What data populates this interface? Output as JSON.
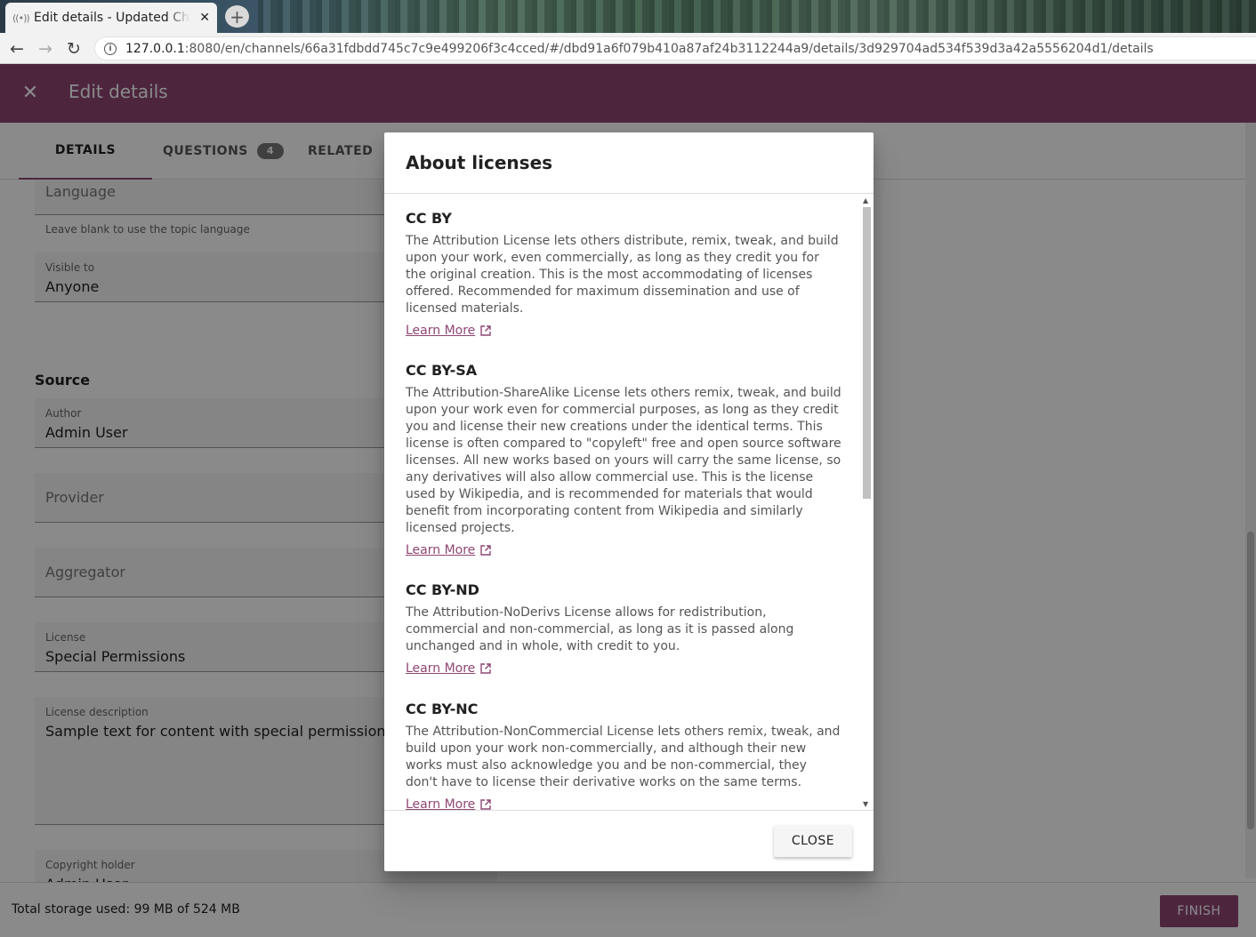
{
  "browser": {
    "tab_title": "Edit details - Updated Channel",
    "url_host": "127.0.0.1",
    "url_rest": ":8080/en/channels/66a31fdbdd745c7c9e499206f3c4cced/#/dbd91a6f079b410a87af24b3112244a9/details/3d929704ad534f539d3a42a5556204d1/details"
  },
  "toolbar": {
    "title": "Edit details"
  },
  "tabs": [
    {
      "label": "DETAILS"
    },
    {
      "label": "QUESTIONS",
      "badge": "4"
    },
    {
      "label": "RELATED"
    }
  ],
  "form": {
    "language_label": "Language",
    "language_hint": "Leave blank to use the topic language",
    "visible_to_label": "Visible to",
    "visible_to_value": "Anyone",
    "source_heading": "Source",
    "author_label": "Author",
    "author_value": "Admin User",
    "provider_label": "Provider",
    "aggregator_label": "Aggregator",
    "license_label": "License",
    "license_value": "Special Permissions",
    "license_desc_label": "License description",
    "license_desc_value": "Sample text for content with special permissions",
    "copyright_label": "Copyright holder",
    "copyright_value": "Admin User"
  },
  "footer": {
    "storage": "Total storage used: 99 MB of 524 MB",
    "finish_label": "FINISH"
  },
  "dialog": {
    "title": "About licenses",
    "learn_more": "Learn More",
    "close_label": "CLOSE",
    "licenses": [
      {
        "name": "CC BY",
        "description": "The Attribution License lets others distribute, remix, tweak, and build upon your work, even commercially, as long as they credit you for the original creation. This is the most accommodating of licenses offered. Recommended for maximum dissemination and use of licensed materials."
      },
      {
        "name": "CC BY-SA",
        "description": "The Attribution-ShareAlike License lets others remix, tweak, and build upon your work even for commercial purposes, as long as they credit you and license their new creations under the identical terms. This license is often compared to \"copyleft\" free and open source software licenses. All new works based on yours will carry the same license, so any derivatives will also allow commercial use. This is the license used by Wikipedia, and is recommended for materials that would benefit from incorporating content from Wikipedia and similarly licensed projects."
      },
      {
        "name": "CC BY-ND",
        "description": "The Attribution-NoDerivs License allows for redistribution, commercial and non-commercial, as long as it is passed along unchanged and in whole, with credit to you."
      },
      {
        "name": "CC BY-NC",
        "description": "The Attribution-NonCommercial License lets others remix, tweak, and build upon your work non-commercially, and although their new works must also acknowledge you and be non-commercial, they don't have to license their derivative works on the same terms."
      }
    ]
  }
}
